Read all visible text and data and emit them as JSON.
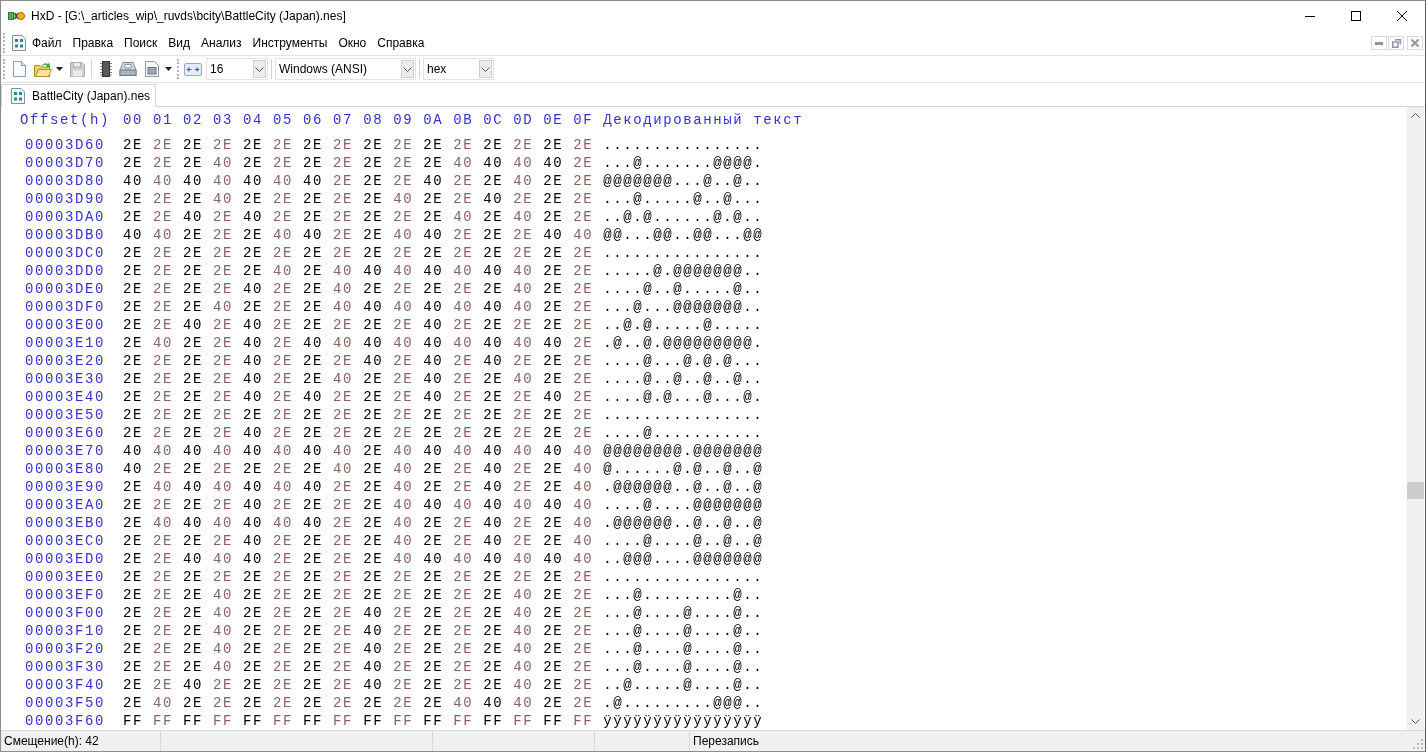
{
  "window": {
    "title": "HxD - [G:\\_articles_wip\\_ruvds\\bcity\\BattleCity (Japan).nes]"
  },
  "menu": [
    "Файл",
    "Правка",
    "Поиск",
    "Вид",
    "Анализ",
    "Инструменты",
    "Окно",
    "Справка"
  ],
  "toolbar": {
    "combos": [
      {
        "value": "16"
      },
      {
        "value": "Windows (ANSI)"
      },
      {
        "value": "hex"
      }
    ]
  },
  "tabs": [
    {
      "label": "BattleCity (Japan).nes",
      "selected": true
    }
  ],
  "hex_view": {
    "header": {
      "offset": "Offset(h)",
      "columns": [
        "00",
        "01",
        "02",
        "03",
        "04",
        "05",
        "06",
        "07",
        "08",
        "09",
        "0A",
        "0B",
        "0C",
        "0D",
        "0E",
        "0F"
      ],
      "text": "Декодированный текст"
    },
    "rows": [
      {
        "offset": "00003D60",
        "bytes": [
          "2E",
          "2E",
          "2E",
          "2E",
          "2E",
          "2E",
          "2E",
          "2E",
          "2E",
          "2E",
          "2E",
          "2E",
          "2E",
          "2E",
          "2E",
          "2E"
        ],
        "text": "................"
      },
      {
        "offset": "00003D70",
        "bytes": [
          "2E",
          "2E",
          "2E",
          "40",
          "2E",
          "2E",
          "2E",
          "2E",
          "2E",
          "2E",
          "2E",
          "40",
          "40",
          "40",
          "40",
          "2E"
        ],
        "text": "...@.......@@@@."
      },
      {
        "offset": "00003D80",
        "bytes": [
          "40",
          "40",
          "40",
          "40",
          "40",
          "40",
          "40",
          "2E",
          "2E",
          "2E",
          "40",
          "2E",
          "2E",
          "40",
          "2E",
          "2E"
        ],
        "text": "@@@@@@@...@..@.."
      },
      {
        "offset": "00003D90",
        "bytes": [
          "2E",
          "2E",
          "2E",
          "40",
          "2E",
          "2E",
          "2E",
          "2E",
          "2E",
          "40",
          "2E",
          "2E",
          "40",
          "2E",
          "2E",
          "2E"
        ],
        "text": "...@.....@..@..."
      },
      {
        "offset": "00003DA0",
        "bytes": [
          "2E",
          "2E",
          "40",
          "2E",
          "40",
          "2E",
          "2E",
          "2E",
          "2E",
          "2E",
          "2E",
          "40",
          "2E",
          "40",
          "2E",
          "2E"
        ],
        "text": "..@.@......@.@.."
      },
      {
        "offset": "00003DB0",
        "bytes": [
          "40",
          "40",
          "2E",
          "2E",
          "2E",
          "40",
          "40",
          "2E",
          "2E",
          "40",
          "40",
          "2E",
          "2E",
          "2E",
          "40",
          "40"
        ],
        "text": "@@...@@..@@...@@"
      },
      {
        "offset": "00003DC0",
        "bytes": [
          "2E",
          "2E",
          "2E",
          "2E",
          "2E",
          "2E",
          "2E",
          "2E",
          "2E",
          "2E",
          "2E",
          "2E",
          "2E",
          "2E",
          "2E",
          "2E"
        ],
        "text": "................"
      },
      {
        "offset": "00003DD0",
        "bytes": [
          "2E",
          "2E",
          "2E",
          "2E",
          "2E",
          "40",
          "2E",
          "40",
          "40",
          "40",
          "40",
          "40",
          "40",
          "40",
          "2E",
          "2E"
        ],
        "text": ".....@.@@@@@@@.."
      },
      {
        "offset": "00003DE0",
        "bytes": [
          "2E",
          "2E",
          "2E",
          "2E",
          "40",
          "2E",
          "2E",
          "40",
          "2E",
          "2E",
          "2E",
          "2E",
          "2E",
          "40",
          "2E",
          "2E"
        ],
        "text": "....@..@.....@.."
      },
      {
        "offset": "00003DF0",
        "bytes": [
          "2E",
          "2E",
          "2E",
          "40",
          "2E",
          "2E",
          "2E",
          "40",
          "40",
          "40",
          "40",
          "40",
          "40",
          "40",
          "2E",
          "2E"
        ],
        "text": "...@...@@@@@@@.."
      },
      {
        "offset": "00003E00",
        "bytes": [
          "2E",
          "2E",
          "40",
          "2E",
          "40",
          "2E",
          "2E",
          "2E",
          "2E",
          "2E",
          "40",
          "2E",
          "2E",
          "2E",
          "2E",
          "2E"
        ],
        "text": "..@.@.....@....."
      },
      {
        "offset": "00003E10",
        "bytes": [
          "2E",
          "40",
          "2E",
          "2E",
          "40",
          "2E",
          "40",
          "40",
          "40",
          "40",
          "40",
          "40",
          "40",
          "40",
          "40",
          "2E"
        ],
        "text": ".@..@.@@@@@@@@@."
      },
      {
        "offset": "00003E20",
        "bytes": [
          "2E",
          "2E",
          "2E",
          "2E",
          "40",
          "2E",
          "2E",
          "2E",
          "40",
          "2E",
          "40",
          "2E",
          "40",
          "2E",
          "2E",
          "2E"
        ],
        "text": "....@...@.@.@..."
      },
      {
        "offset": "00003E30",
        "bytes": [
          "2E",
          "2E",
          "2E",
          "2E",
          "40",
          "2E",
          "2E",
          "40",
          "2E",
          "2E",
          "40",
          "2E",
          "2E",
          "40",
          "2E",
          "2E"
        ],
        "text": "....@..@..@..@.."
      },
      {
        "offset": "00003E40",
        "bytes": [
          "2E",
          "2E",
          "2E",
          "2E",
          "40",
          "2E",
          "40",
          "2E",
          "2E",
          "2E",
          "40",
          "2E",
          "2E",
          "2E",
          "40",
          "2E"
        ],
        "text": "....@.@...@...@."
      },
      {
        "offset": "00003E50",
        "bytes": [
          "2E",
          "2E",
          "2E",
          "2E",
          "2E",
          "2E",
          "2E",
          "2E",
          "2E",
          "2E",
          "2E",
          "2E",
          "2E",
          "2E",
          "2E",
          "2E"
        ],
        "text": "................"
      },
      {
        "offset": "00003E60",
        "bytes": [
          "2E",
          "2E",
          "2E",
          "2E",
          "40",
          "2E",
          "2E",
          "2E",
          "2E",
          "2E",
          "2E",
          "2E",
          "2E",
          "2E",
          "2E",
          "2E"
        ],
        "text": "....@..........."
      },
      {
        "offset": "00003E70",
        "bytes": [
          "40",
          "40",
          "40",
          "40",
          "40",
          "40",
          "40",
          "40",
          "2E",
          "40",
          "40",
          "40",
          "40",
          "40",
          "40",
          "40"
        ],
        "text": "@@@@@@@@.@@@@@@@"
      },
      {
        "offset": "00003E80",
        "bytes": [
          "40",
          "2E",
          "2E",
          "2E",
          "2E",
          "2E",
          "2E",
          "40",
          "2E",
          "40",
          "2E",
          "2E",
          "40",
          "2E",
          "2E",
          "40"
        ],
        "text": "@......@.@..@..@"
      },
      {
        "offset": "00003E90",
        "bytes": [
          "2E",
          "40",
          "40",
          "40",
          "40",
          "40",
          "40",
          "2E",
          "2E",
          "40",
          "2E",
          "2E",
          "40",
          "2E",
          "2E",
          "40"
        ],
        "text": ".@@@@@@..@..@..@"
      },
      {
        "offset": "00003EA0",
        "bytes": [
          "2E",
          "2E",
          "2E",
          "2E",
          "40",
          "2E",
          "2E",
          "2E",
          "2E",
          "40",
          "40",
          "40",
          "40",
          "40",
          "40",
          "40"
        ],
        "text": "....@....@@@@@@@"
      },
      {
        "offset": "00003EB0",
        "bytes": [
          "2E",
          "40",
          "40",
          "40",
          "40",
          "40",
          "40",
          "2E",
          "2E",
          "40",
          "2E",
          "2E",
          "40",
          "2E",
          "2E",
          "40"
        ],
        "text": ".@@@@@@..@..@..@"
      },
      {
        "offset": "00003EC0",
        "bytes": [
          "2E",
          "2E",
          "2E",
          "2E",
          "40",
          "2E",
          "2E",
          "2E",
          "2E",
          "40",
          "2E",
          "2E",
          "40",
          "2E",
          "2E",
          "40"
        ],
        "text": "....@....@..@..@"
      },
      {
        "offset": "00003ED0",
        "bytes": [
          "2E",
          "2E",
          "40",
          "40",
          "40",
          "2E",
          "2E",
          "2E",
          "2E",
          "40",
          "40",
          "40",
          "40",
          "40",
          "40",
          "40"
        ],
        "text": "..@@@....@@@@@@@"
      },
      {
        "offset": "00003EE0",
        "bytes": [
          "2E",
          "2E",
          "2E",
          "2E",
          "2E",
          "2E",
          "2E",
          "2E",
          "2E",
          "2E",
          "2E",
          "2E",
          "2E",
          "2E",
          "2E",
          "2E"
        ],
        "text": "................"
      },
      {
        "offset": "00003EF0",
        "bytes": [
          "2E",
          "2E",
          "2E",
          "40",
          "2E",
          "2E",
          "2E",
          "2E",
          "2E",
          "2E",
          "2E",
          "2E",
          "2E",
          "40",
          "2E",
          "2E"
        ],
        "text": "...@.........@.."
      },
      {
        "offset": "00003F00",
        "bytes": [
          "2E",
          "2E",
          "2E",
          "40",
          "2E",
          "2E",
          "2E",
          "2E",
          "40",
          "2E",
          "2E",
          "2E",
          "2E",
          "40",
          "2E",
          "2E"
        ],
        "text": "...@....@....@.."
      },
      {
        "offset": "00003F10",
        "bytes": [
          "2E",
          "2E",
          "2E",
          "40",
          "2E",
          "2E",
          "2E",
          "2E",
          "40",
          "2E",
          "2E",
          "2E",
          "2E",
          "40",
          "2E",
          "2E"
        ],
        "text": "...@....@....@.."
      },
      {
        "offset": "00003F20",
        "bytes": [
          "2E",
          "2E",
          "2E",
          "40",
          "2E",
          "2E",
          "2E",
          "2E",
          "40",
          "2E",
          "2E",
          "2E",
          "2E",
          "40",
          "2E",
          "2E"
        ],
        "text": "...@....@....@.."
      },
      {
        "offset": "00003F30",
        "bytes": [
          "2E",
          "2E",
          "2E",
          "40",
          "2E",
          "2E",
          "2E",
          "2E",
          "40",
          "2E",
          "2E",
          "2E",
          "2E",
          "40",
          "2E",
          "2E"
        ],
        "text": "...@....@....@.."
      },
      {
        "offset": "00003F40",
        "bytes": [
          "2E",
          "2E",
          "40",
          "2E",
          "2E",
          "2E",
          "2E",
          "2E",
          "40",
          "2E",
          "2E",
          "2E",
          "2E",
          "40",
          "2E",
          "2E"
        ],
        "text": "..@.....@....@.."
      },
      {
        "offset": "00003F50",
        "bytes": [
          "2E",
          "40",
          "2E",
          "2E",
          "2E",
          "2E",
          "2E",
          "2E",
          "2E",
          "2E",
          "2E",
          "40",
          "40",
          "40",
          "2E",
          "2E"
        ],
        "text": ".@.........@@@.."
      },
      {
        "offset": "00003F60",
        "bytes": [
          "FF",
          "FF",
          "FF",
          "FF",
          "FF",
          "FF",
          "FF",
          "FF",
          "FF",
          "FF",
          "FF",
          "FF",
          "FF",
          "FF",
          "FF",
          "FF"
        ],
        "text": "ÿÿÿÿÿÿÿÿÿÿÿÿÿÿÿÿ"
      }
    ]
  },
  "status_bar": {
    "offset": "Смещение(h): 42",
    "mode": "Перезапись"
  }
}
